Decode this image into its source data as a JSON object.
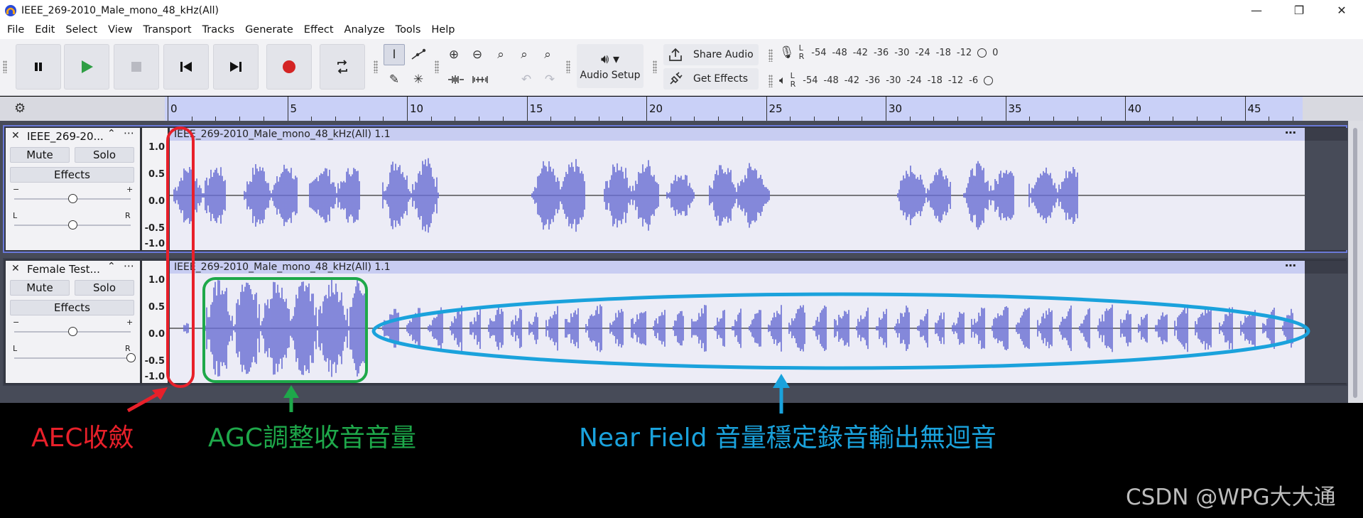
{
  "window": {
    "title": "IEEE_269-2010_Male_mono_48_kHz(All)",
    "controls": [
      "—",
      "❐",
      "✕"
    ]
  },
  "menus": [
    "File",
    "Edit",
    "Select",
    "View",
    "Transport",
    "Tracks",
    "Generate",
    "Effect",
    "Analyze",
    "Tools",
    "Help"
  ],
  "toolbar": {
    "audio_setup_label": "Audio Setup",
    "share_audio_label": "Share Audio",
    "get_effects_label": "Get Effects",
    "record_meter": {
      "l": "L",
      "r": "R",
      "ticks": [
        "-54",
        "-48",
        "-42",
        "-36",
        "-30",
        "-24",
        "-18",
        "-12"
      ],
      "end": "0"
    },
    "play_meter": {
      "l": "L",
      "r": "R",
      "ticks": [
        "-54",
        "-48",
        "-42",
        "-36",
        "-30",
        "-24",
        "-18",
        "-12",
        "-6"
      ]
    }
  },
  "ruler": {
    "labels": [
      "0",
      "5",
      "10",
      "15",
      "20",
      "25",
      "30",
      "35",
      "40",
      "45"
    ]
  },
  "tracks": [
    {
      "name": "IEEE_269-20...",
      "clip_title": "IEEE_269-2010_Male_mono_48_kHz(All) 1.1",
      "mute": "Mute",
      "solo": "Solo",
      "effects": "Effects",
      "gain": 0.5,
      "pan": 0.0,
      "scale": [
        "1.0",
        "0.5",
        "0.0",
        "-0.5",
        "-1.0"
      ],
      "selected": true
    },
    {
      "name": "Female Test...",
      "clip_title": "IEEE_269-2010_Male_mono_48_kHz(All) 1.1",
      "mute": "Mute",
      "solo": "Solo",
      "effects": "Effects",
      "gain": 0.5,
      "pan": 1.0,
      "scale": [
        "1.0",
        "0.5",
        "0.0",
        "-0.5",
        "-1.0"
      ],
      "selected": false
    }
  ],
  "slider_labels": {
    "minus": "−",
    "plus": "+",
    "left": "L",
    "right": "R"
  },
  "annotations": {
    "aec": "AEC收斂",
    "agc": "AGC調整收音音量",
    "near_field": "Near Field 音量穩定錄音輸出無迴音",
    "watermark": "CSDN @WPG大大通"
  },
  "colors": {
    "aec": "#e8202a",
    "agc": "#1ea84a",
    "near_field": "#1aa2dc",
    "waveform": "#6a6fd4"
  }
}
